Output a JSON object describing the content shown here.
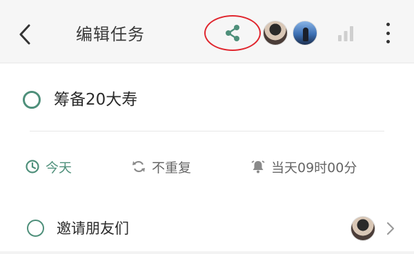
{
  "header": {
    "title": "编辑任务",
    "accent_color": "#4e8f7a",
    "highlight_ring_color": "#e0262e",
    "icons": {
      "back": "chevron-left-icon",
      "share": "share-icon",
      "stats": "bar-chart-icon",
      "more": "more-vertical-icon"
    }
  },
  "task": {
    "title": "筹备20大寿"
  },
  "meta": {
    "date": "今天",
    "repeat": "不重复",
    "reminder": "当天09时00分"
  },
  "invite": {
    "label": "邀请朋友们"
  }
}
